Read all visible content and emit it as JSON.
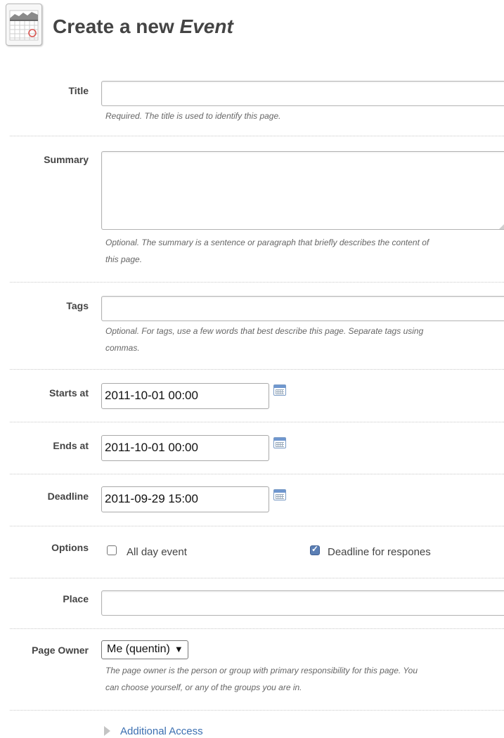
{
  "header": {
    "title_prefix": "Create a new ",
    "title_emphasis": "Event",
    "icon": "calendar-app-icon"
  },
  "form": {
    "title": {
      "label": "Title",
      "value": "",
      "help": "Required. The title is used to identify this page."
    },
    "summary": {
      "label": "Summary",
      "value": "",
      "help_line1": "Optional. The summary is a sentence or paragraph that briefly describes the content of",
      "help_line2": "this page."
    },
    "tags": {
      "label": "Tags",
      "value": "",
      "help_line1": "Optional. For tags, use a few words that best describe this page. Separate tags using",
      "help_line2": "commas."
    },
    "starts_at": {
      "label": "Starts at",
      "value": "2011-10-01 00:00",
      "icon": "calendar-icon"
    },
    "ends_at": {
      "label": "Ends at",
      "value": "2011-10-01 00:00",
      "icon": "calendar-icon"
    },
    "deadline": {
      "label": "Deadline",
      "value": "2011-09-29 15:00",
      "icon": "calendar-icon"
    },
    "options": {
      "label": "Options",
      "all_day": {
        "label": "All day event",
        "checked": false
      },
      "deadline_responses": {
        "label": "Deadline for respones",
        "checked": true
      }
    },
    "place": {
      "label": "Place",
      "value": ""
    },
    "page_owner": {
      "label": "Page Owner",
      "selected": "Me (quentin)",
      "arrow": "▼",
      "help_line1": "The page owner is the person or group with primary responsibility for this page. You",
      "help_line2": "can choose yourself, or any of the groups you are in."
    },
    "additional_access": {
      "label": "Additional Access"
    }
  },
  "colors": {
    "link": "#3b6fb1",
    "checkbox_checked": "#5b7fb5",
    "divider": "#c8c8c8"
  }
}
